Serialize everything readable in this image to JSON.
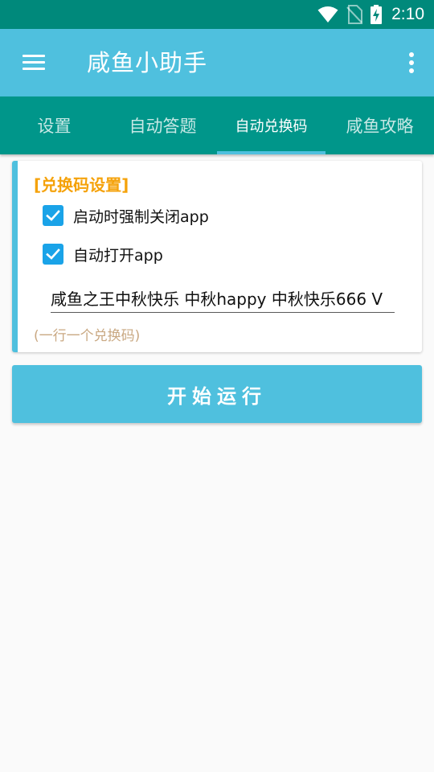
{
  "status_bar": {
    "time": "2:10",
    "icons": [
      "wifi-icon",
      "no-sim-icon",
      "battery-charging-icon"
    ]
  },
  "app_bar": {
    "title": "咸鱼小助手",
    "menu_icon": "hamburger-menu-icon",
    "more_icon": "more-vertical-icon"
  },
  "tabs": [
    {
      "label": "设置",
      "active": false
    },
    {
      "label": "自动答题",
      "active": false
    },
    {
      "label": "自动兑换码",
      "active": true
    },
    {
      "label": "咸鱼攻略",
      "active": false
    }
  ],
  "settings": {
    "title": "[兑换码设置]",
    "options": [
      {
        "label": "启动时强制关闭app",
        "checked": true
      },
      {
        "label": "自动打开app",
        "checked": true
      }
    ],
    "codes_value": "咸鱼之王中秋快乐 中秋happy 中秋快乐666 V",
    "hint": "(一行一个兑换码)"
  },
  "start_button": {
    "label": "开始运行"
  },
  "colors": {
    "status_bar": "#00897b",
    "app_bar": "#4fc0de",
    "tab_bar": "#00968a",
    "accent": "#4fc0de",
    "card_title": "#f5a20a",
    "checkbox": "#1aa3e8",
    "hint": "#c9a882"
  }
}
